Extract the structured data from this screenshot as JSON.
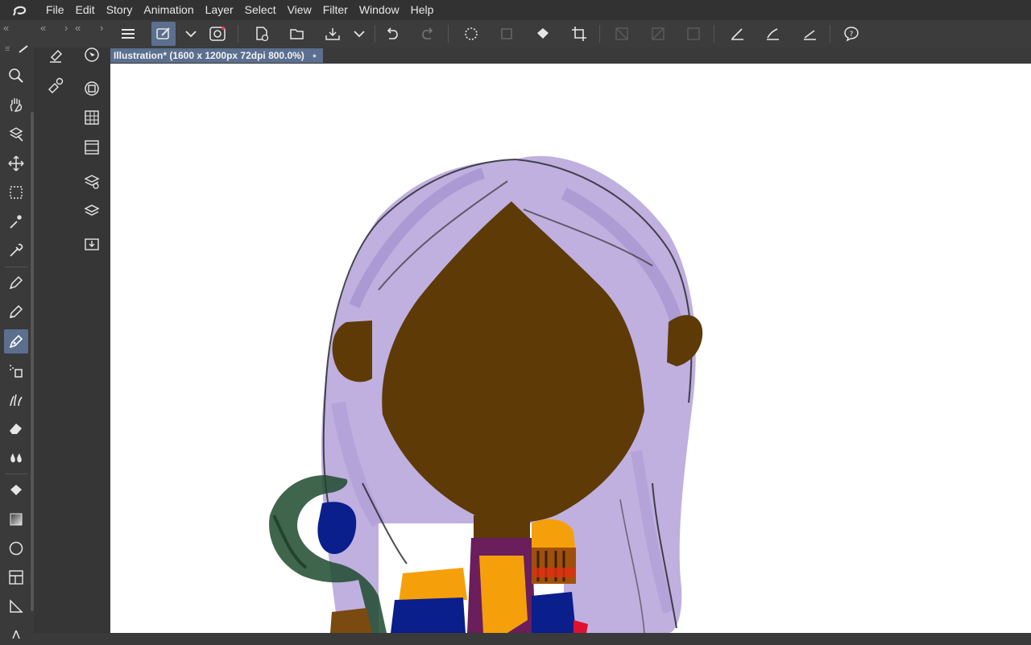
{
  "menubar": {
    "logo_icon": "clip-studio-logo-icon",
    "items": [
      {
        "label": "File"
      },
      {
        "label": "Edit"
      },
      {
        "label": "Story"
      },
      {
        "label": "Animation"
      },
      {
        "label": "Layer"
      },
      {
        "label": "Select"
      },
      {
        "label": "View"
      },
      {
        "label": "Filter"
      },
      {
        "label": "Window"
      },
      {
        "label": "Help"
      }
    ]
  },
  "toolbar": {
    "collapse_left": "«",
    "collapse_mid_left": "›",
    "collapse_mid_right": "‹",
    "collapse_right": "«",
    "buttons": [
      "menu-icon",
      "brush-settings-icon",
      "dropdown-chevron-icon",
      "spiral-icon",
      "new-document-icon",
      "open-folder-icon",
      "save-icon",
      "save-dropdown-icon",
      "undo-icon",
      "redo-icon",
      "deselect-icon",
      "selection-icon",
      "fill-bucket-icon",
      "crop-icon",
      "disabled-icon-1",
      "disabled-icon-2",
      "disabled-icon-3",
      "pen-pressure-icon",
      "brush-curve-icon",
      "line-icon",
      "help-icon"
    ]
  },
  "document_tab": {
    "title": "Illustration* (1600 x 1200px 72dpi 800.0%)",
    "dot": "●"
  },
  "tools": [
    "zoom-icon",
    "hand-icon",
    "rotate-layer-select-icon",
    "move-icon",
    "marquee-icon",
    "magic-wand-icon",
    "eyedropper-icon",
    "pen-icon",
    "pencil-icon",
    "brush-pen-icon",
    "airbrush-icon",
    "decoration-icon",
    "eraser-icon",
    "blend-icon",
    "fill-icon",
    "gradient-icon",
    "figure-icon",
    "frame-icon",
    "ruler-icon"
  ],
  "colors": {
    "menubar_bg": "#323232",
    "toolbar_bg": "#3c3c3c",
    "active_tool": "#5b6f8f",
    "canvas_bg": "#ffffff",
    "hair": "#b8a8dc",
    "skin": "#5e3a06",
    "gold": "#f5a00a",
    "navy": "#0a1e8c",
    "purple": "#6a1e5c",
    "green": "#1e4a2e"
  }
}
